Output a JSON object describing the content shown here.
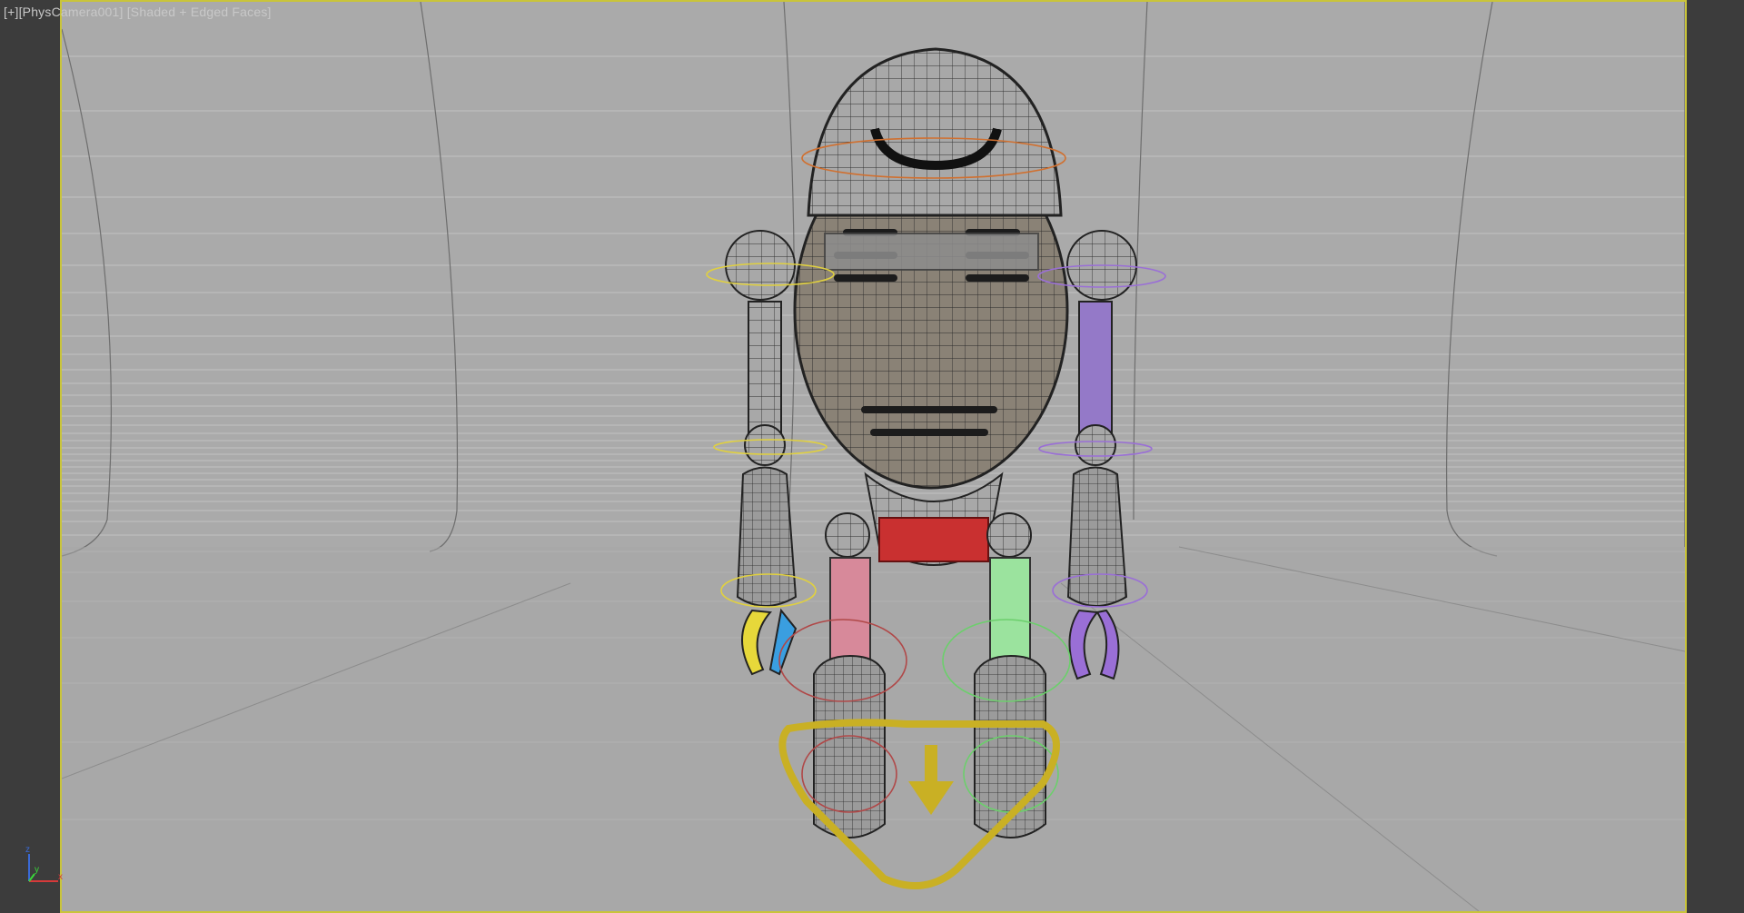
{
  "viewport": {
    "label_plus": "[+]",
    "label_camera": "[PhysCamera001]",
    "label_shading": "[Shaded + Edged Faces]",
    "accent_border": "#c9c43a"
  },
  "gizmo": {
    "axis_x": "x",
    "axis_y": "y",
    "axis_z": "z"
  },
  "scene": {
    "model": "robot-rig",
    "arrow_icon": "down-arrow-icon"
  }
}
